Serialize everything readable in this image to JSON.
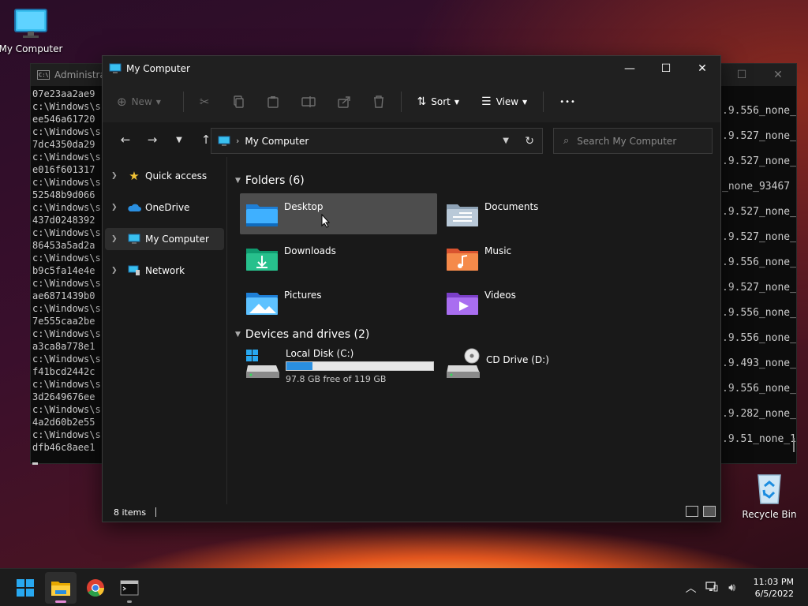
{
  "desktop": {
    "icons": [
      {
        "label": "My Computer",
        "icon": "monitor-icon"
      },
      {
        "label": "Recycle Bin",
        "icon": "recycle-bin-icon"
      }
    ]
  },
  "terminal": {
    "title": "Administrat",
    "left_lines": [
      "07e23aa2ae9",
      "c:\\Windows\\s",
      "ee546a61720",
      "c:\\Windows\\s",
      "7dc4350da29",
      "c:\\Windows\\s",
      "e016f601317",
      "c:\\Windows\\s",
      "52548b9d066",
      "c:\\Windows\\s",
      "437d0248392",
      "c:\\Windows\\s",
      "86453a5ad2a",
      "c:\\Windows\\s",
      "b9c5fa14e4e",
      "c:\\Windows\\s",
      "ae6871439b0",
      "c:\\Windows\\s",
      "7e555caa2be",
      "c:\\Windows\\s",
      "a3ca8a778e1",
      "c:\\Windows\\s",
      "f41bcd2442c",
      "c:\\Windows\\s",
      "3d2649676ee",
      "c:\\Windows\\s",
      "4a2d60b2e55",
      "c:\\Windows\\s",
      "dfb46c8aee1"
    ],
    "right_lines": [
      ".9.556_none_",
      ".9.527_none_",
      ".9.527_none_",
      "_none_93467",
      ".9.527_none_",
      ".9.527_none_",
      ".9.556_none_",
      ".9.527_none_",
      ".9.556_none_",
      ".9.556_none_",
      ".9.493_none_",
      ".9.556_none_",
      ".9.282_none_",
      ".9.51_none_1"
    ]
  },
  "explorer": {
    "title": "My Computer",
    "toolbar": {
      "new_label": "New",
      "sort_label": "Sort",
      "view_label": "View",
      "more_label": "•••"
    },
    "address": {
      "crumb": "My Computer"
    },
    "search": {
      "placeholder": "Search My Computer"
    },
    "sidebar": [
      {
        "label": "Quick access",
        "icon": "star-icon",
        "active": false
      },
      {
        "label": "OneDrive",
        "icon": "cloud-icon",
        "active": false
      },
      {
        "label": "My Computer",
        "icon": "monitor-icon",
        "active": true
      },
      {
        "label": "Network",
        "icon": "network-icon",
        "active": false
      }
    ],
    "folders_header": "Folders (6)",
    "folders": [
      {
        "name": "Desktop",
        "icon": "desktop-folder-icon",
        "selected": true
      },
      {
        "name": "Documents",
        "icon": "documents-folder-icon",
        "selected": false
      },
      {
        "name": "Downloads",
        "icon": "downloads-folder-icon",
        "selected": false
      },
      {
        "name": "Music",
        "icon": "music-folder-icon",
        "selected": false
      },
      {
        "name": "Pictures",
        "icon": "pictures-folder-icon",
        "selected": false
      },
      {
        "name": "Videos",
        "icon": "videos-folder-icon",
        "selected": false
      }
    ],
    "drives_header": "Devices and drives (2)",
    "drives": [
      {
        "name": "Local Disk (C:)",
        "free_text": "97.8 GB free of 119 GB",
        "used_fraction": 0.18,
        "icon": "hard-disk-icon"
      },
      {
        "name": "CD Drive (D:)",
        "icon": "cd-drive-icon"
      }
    ],
    "status": {
      "items": "8 items"
    }
  },
  "taskbar": {
    "apps": [
      "start-icon",
      "file-explorer-icon",
      "chrome-icon",
      "terminal-icon"
    ],
    "time": "11:03 PM",
    "date": "6/5/2022"
  },
  "colors": {
    "accent": "#2a8fe0",
    "selection": "#4d4d4d",
    "window_bg": "#191919"
  }
}
